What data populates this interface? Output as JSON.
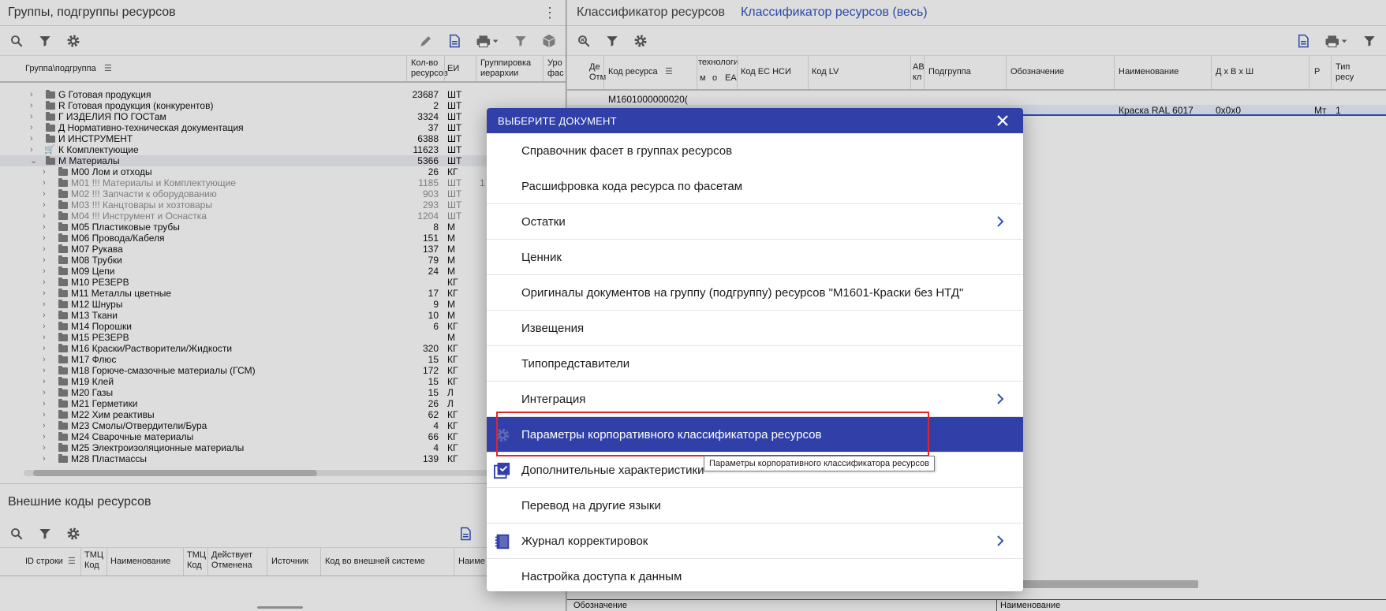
{
  "left": {
    "title": "Группы, подгруппы ресурсов",
    "columns": {
      "group": "Группа\\подгруппа",
      "count": "Кол-во\nресурсов",
      "unit": "ЕИ",
      "hier": "Группировка\nиерархии",
      "fac": "Уро\nфас"
    },
    "rows": [
      {
        "text": "G Готовая продукция",
        "count": "23687",
        "unit": "ШТ"
      },
      {
        "text": "R Готовая продукция (конкурентов)",
        "count": "2",
        "unit": "ШТ"
      },
      {
        "text": "Г ИЗДЕЛИЯ ПО ГОСТам",
        "count": "3324",
        "unit": "ШТ"
      },
      {
        "text": "Д Нормативно-техническая документация",
        "count": "37",
        "unit": "ШТ"
      },
      {
        "text": "И ИНСТРУМЕНТ",
        "count": "6388",
        "unit": "ШТ"
      },
      {
        "text": "К Комплектующие",
        "count": "11623",
        "unit": "ШТ"
      },
      {
        "text": "М Материалы",
        "count": "5366",
        "unit": "ШТ"
      },
      {
        "text": "М00 Лом и отходы",
        "count": "26",
        "unit": "КГ"
      },
      {
        "text": "М01 !!!   Материалы и Комплектующие",
        "count": "1185",
        "unit": "ШТ",
        "extra": "1"
      },
      {
        "text": "М02 !!!   Запчасти к оборудованию",
        "count": "903",
        "unit": "ШТ"
      },
      {
        "text": "М03 !!!   Канцтовары и хозтовары",
        "count": "293",
        "unit": "ШТ"
      },
      {
        "text": "М04 !!!   Инструмент и Оснастка",
        "count": "1204",
        "unit": "ШТ"
      },
      {
        "text": "М05 Пластиковые трубы",
        "count": "8",
        "unit": "М"
      },
      {
        "text": "М06 Провода/Кабеля",
        "count": "151",
        "unit": "М"
      },
      {
        "text": "М07 Рукава",
        "count": "137",
        "unit": "М"
      },
      {
        "text": "М08 Трубки",
        "count": "79",
        "unit": "М"
      },
      {
        "text": "М09 Цепи",
        "count": "24",
        "unit": "М"
      },
      {
        "text": "М10 РЕЗЕРВ",
        "count": "",
        "unit": "КГ"
      },
      {
        "text": "М11 Металлы цветные",
        "count": "17",
        "unit": "КГ"
      },
      {
        "text": "М12 Шнуры",
        "count": "9",
        "unit": "М"
      },
      {
        "text": "М13 Ткани",
        "count": "10",
        "unit": "М"
      },
      {
        "text": "М14 Порошки",
        "count": "6",
        "unit": "КГ"
      },
      {
        "text": "М15 РЕЗЕРВ",
        "count": "",
        "unit": "М"
      },
      {
        "text": "М16 Краски/Растворители/Жидкости",
        "count": "320",
        "unit": "КГ"
      },
      {
        "text": "М17 Флюс",
        "count": "15",
        "unit": "КГ"
      },
      {
        "text": "М18 Горюче-смазочные материалы (ГСМ)",
        "count": "172",
        "unit": "КГ"
      },
      {
        "text": "М19 Клей",
        "count": "15",
        "unit": "КГ"
      },
      {
        "text": "М20 Газы",
        "count": "15",
        "unit": "Л"
      },
      {
        "text": "М21 Герметики",
        "count": "26",
        "unit": "Л"
      },
      {
        "text": "М22 Хим реактивы",
        "count": "62",
        "unit": "КГ"
      },
      {
        "text": "М23 Смолы/Отвердители/Бура",
        "count": "4",
        "unit": "КГ"
      },
      {
        "text": "М24 Сварочные материалы",
        "count": "66",
        "unit": "КГ"
      },
      {
        "text": "М25 Электроизоляционные материалы",
        "count": "4",
        "unit": "КГ"
      },
      {
        "text": "М28 Пластмассы",
        "count": "139",
        "unit": "КГ"
      }
    ]
  },
  "ext": {
    "title": "Внешние коды ресурсов",
    "columns": {
      "id": "ID строки",
      "tmc1": "ТМЦ\nКод",
      "name": "Наименование",
      "tmc2": "ТМЦ\nКод",
      "valid": "Действует\nОтменена",
      "source": "Источник",
      "extcode": "Код во внешней системе",
      "name2": "Наиме"
    }
  },
  "right": {
    "tabs": [
      "Классификатор ресурсов",
      "Классификатор ресурсов (весь)"
    ],
    "columns": {
      "de": "Де\nОтм",
      "code": "Код ресурса",
      "tech": "технологи",
      "m": "м",
      "o": "о",
      "ea": "ЕА",
      "nsi": "Код ЕС НСИ",
      "lv": "Код LV",
      "av": "АВ\nкл",
      "sub": "Подгруппа",
      "desig": "Обозначение",
      "name": "Наименование",
      "dims": "Д х В х Ш",
      "p": "Р",
      "type": "Тип\nресу"
    },
    "row1": {
      "code": "М1601000000020("
    },
    "row2": {
      "name": "Краска RAL 6017",
      "dims": "0x0x0",
      "p": "Мт",
      "type": "1"
    },
    "bottom": {
      "desig": "Обозначение",
      "name": "Наименование"
    }
  },
  "dialog": {
    "title": "ВЫБЕРИТЕ ДОКУМЕНТ",
    "items": [
      {
        "label": "Справочник фасет в группах ресурсов"
      },
      {
        "label": "Расшифровка кода ресурса по фасетам"
      },
      {
        "label": "Остатки"
      },
      {
        "label": "Ценник"
      },
      {
        "label": "Оригиналы документов на группу (подгруппу) ресурсов \"М1601-Краски без НТД\""
      },
      {
        "label": "Извещения"
      },
      {
        "label": "Типопредставители"
      },
      {
        "label": "Интеграция"
      },
      {
        "label": "Параметры корпоративного классификатора ресурсов"
      },
      {
        "label": "Дополнительные характеристики"
      },
      {
        "label": "Перевод на другие языки"
      },
      {
        "label": "Журнал корректировок"
      },
      {
        "label": "Настройка доступа к данным"
      }
    ],
    "tooltip": "Параметры корпоративного классификатора ресурсов"
  },
  "colors": {
    "accent": "#3140a8",
    "tab_active": "#2f52b7",
    "highlight_box": "#e0242b"
  }
}
